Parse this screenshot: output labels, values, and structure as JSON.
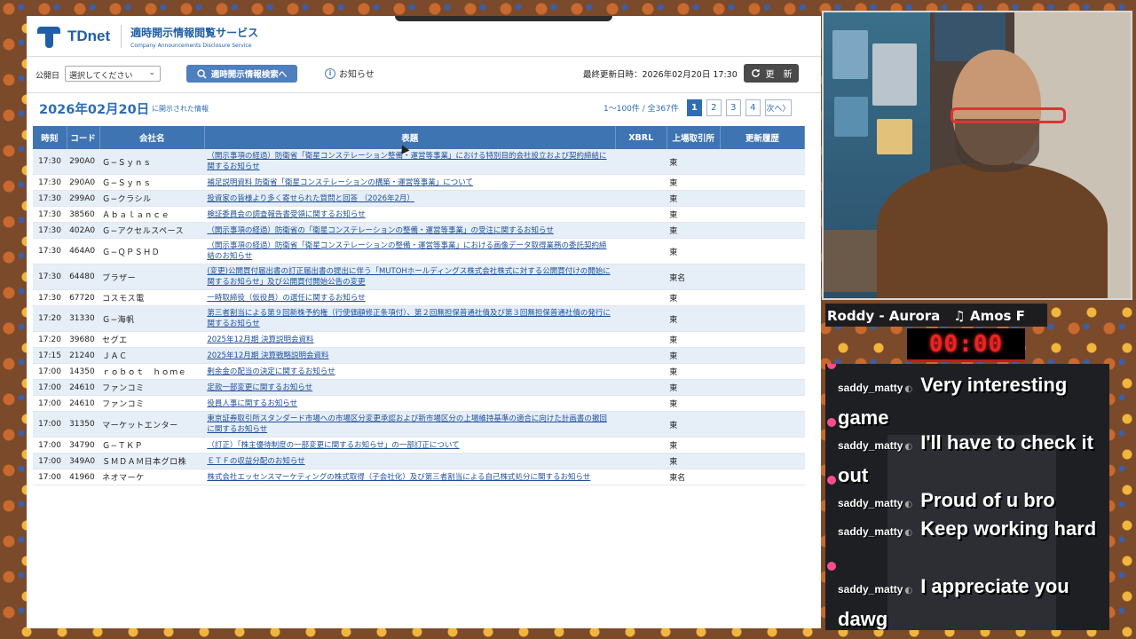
{
  "site": {
    "logo_text": "TDnet",
    "service_jp": "適時開示情報閲覧サービス",
    "service_en": "Company Announcements Disclosure Service"
  },
  "filter": {
    "date_label": "公開日",
    "date_placeholder": "選択してください",
    "search_button": "適時開示情報検索へ",
    "notice_label": "お知らせ",
    "last_updated": "最終更新日時：2026年02月20日 17:30",
    "refresh_label": "更　新"
  },
  "list_header": {
    "date": "2026年02月20日",
    "subtitle": "に開示された情報",
    "range": "1〜100件 / 全367件",
    "pages": [
      "1",
      "2",
      "3",
      "4"
    ],
    "next": "次へ"
  },
  "table": {
    "headers": [
      "時刻",
      "コード",
      "会社名",
      "表題",
      "XBRL",
      "上場取引所",
      "更新履歴"
    ],
    "rows": [
      {
        "time": "17:30",
        "code": "290A0",
        "company": "Ｇ−Ｓｙｎｓ",
        "title": "（開示事項の経過）防衛省「衛星コンステレーション整備・運営等事業」における特別目的会社設立および契約締結に関するお知らせ",
        "xbrl": "",
        "market": "東",
        "history": ""
      },
      {
        "time": "17:30",
        "code": "290A0",
        "company": "Ｇ−Ｓｙｎｓ",
        "title": "補足説明資料 防衛省「衛星コンステレーションの構築・運営等事業」について",
        "xbrl": "",
        "market": "東",
        "history": ""
      },
      {
        "time": "17:30",
        "code": "299A0",
        "company": "Ｇ−クラシル",
        "title": "投資家の皆様より多く寄せられた質問と回答 （2026年2月）",
        "xbrl": "",
        "market": "東",
        "history": ""
      },
      {
        "time": "17:30",
        "code": "38560",
        "company": "Ａｂａｌａｎｃｅ",
        "title": "検証委員会の調査報告書受領に関するお知らせ",
        "xbrl": "",
        "market": "東",
        "history": ""
      },
      {
        "time": "17:30",
        "code": "402A0",
        "company": "Ｇ−アクセルスペース",
        "title": "（開示事項の経過）防衛省の「衛星コンステレーションの整備・運営等事業」の受注に関するお知らせ",
        "xbrl": "",
        "market": "東",
        "history": ""
      },
      {
        "time": "17:30",
        "code": "464A0",
        "company": "Ｇ−ＱＰＳＨＤ",
        "title": "（開示事項の経過）防衛省「衛星コンステレーションの整備・運営等事業」における画像データ取得業務の委託契約締結のお知らせ",
        "xbrl": "",
        "market": "東",
        "history": ""
      },
      {
        "time": "17:30",
        "code": "64480",
        "company": "ブラザー",
        "title": "(変更)公開買付届出書の訂正届出書の提出に伴う「MUTOHホールディングス株式会社株式に対する公開買付けの開始に関するお知らせ」及び公開買付開始公告の変更",
        "xbrl": "",
        "market": "東名",
        "history": ""
      },
      {
        "time": "17:30",
        "code": "67720",
        "company": "コスモス電",
        "title": "一時取締役（仮役員）の選任に関するお知らせ",
        "xbrl": "",
        "market": "東",
        "history": ""
      },
      {
        "time": "17:20",
        "code": "31330",
        "company": "Ｇ−海帆",
        "title": "第三者割当による第９回新株予約権（行使価額修正条項付）、第２回無担保普通社債及び第３回無担保普通社債の発行に関するお知らせ",
        "xbrl": "",
        "market": "東",
        "history": ""
      },
      {
        "time": "17:20",
        "code": "39680",
        "company": "セグエ",
        "title": "2025年12月期 決算説明会資料",
        "xbrl": "",
        "market": "東",
        "history": ""
      },
      {
        "time": "17:15",
        "code": "21240",
        "company": "ＪＡＣ",
        "title": "2025年12月期 決算戦略説明会資料",
        "xbrl": "",
        "market": "東",
        "history": ""
      },
      {
        "time": "17:00",
        "code": "14350",
        "company": "ｒｏｂｏｔ　ｈｏｍｅ",
        "title": "剰余金の配当の決定に関するお知らせ",
        "xbrl": "",
        "market": "東",
        "history": ""
      },
      {
        "time": "17:00",
        "code": "24610",
        "company": "ファンコミ",
        "title": "定款一部変更に関するお知らせ",
        "xbrl": "",
        "market": "東",
        "history": ""
      },
      {
        "time": "17:00",
        "code": "24610",
        "company": "ファンコミ",
        "title": "役員人事に関するお知らせ",
        "xbrl": "",
        "market": "東",
        "history": ""
      },
      {
        "time": "17:00",
        "code": "31350",
        "company": "マーケットエンター",
        "title": "東京証券取引所スタンダード市場への市場区分変更承認および新市場区分の上場維持基準の適合に向けた計画書の撤回に関するお知らせ",
        "xbrl": "",
        "market": "東",
        "history": ""
      },
      {
        "time": "17:00",
        "code": "34790",
        "company": "Ｇ−ＴＫＰ",
        "title": "（訂正）「株主優待制度の一部変更に関するお知らせ」の一部訂正について",
        "xbrl": "",
        "market": "東",
        "history": ""
      },
      {
        "time": "17:00",
        "code": "349A0",
        "company": "ＳＭＤＡＭ日本グロ株",
        "title": "ＥＴＦの収益分配のお知らせ",
        "xbrl": "",
        "market": "東",
        "history": ""
      },
      {
        "time": "17:00",
        "code": "41960",
        "company": "ネオマーケ",
        "title": "株式会社エッセンスマーケティングの株式取得（子会社化）及び第三者割当による自己株式処分に関するお知らせ",
        "xbrl": "",
        "market": "東名",
        "history": ""
      }
    ]
  },
  "stream": {
    "now_playing": "Roddy - Aurora　♫ Amos F",
    "timer": "00:00",
    "chat": [
      {
        "user": "saddy_matty",
        "text": "Very interesting game"
      },
      {
        "user": "saddy_matty",
        "text": "I'll have to check it out"
      },
      {
        "user": "saddy_matty",
        "text": "Proud of u bro"
      },
      {
        "user": "saddy_matty",
        "text": "Keep working hard"
      },
      {
        "user": "saddy_matty",
        "text": "I appreciate you dawg"
      }
    ]
  }
}
